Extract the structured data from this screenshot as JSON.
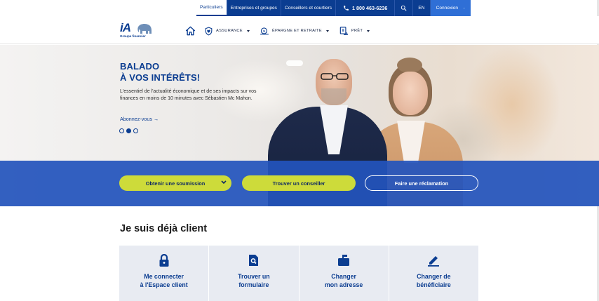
{
  "topbar": {
    "items": [
      {
        "label": "Particuliers"
      },
      {
        "label": "Entreprises et groupes"
      },
      {
        "label": "Conseillers et courtiers"
      },
      {
        "label": "1 800 463-6236"
      },
      {
        "label": "EN"
      },
      {
        "label": "Connexion"
      }
    ]
  },
  "logo": {
    "mark": "iA",
    "subtitle": "Groupe financier"
  },
  "mainnav": {
    "items": [
      {
        "label": "ASSURANCE"
      },
      {
        "label": "ÉPARGNE ET RETRAITE"
      },
      {
        "label": "PRÊT"
      }
    ]
  },
  "hero": {
    "title_line1": "BALADO",
    "title_line2": "À VOS INTÉRÊTS!",
    "text": "L'essentiel de l'actualité économique et de ses impacts sur vos finances en moins de 10 minutes avec Sébastien Mc Mahon.",
    "link": "Abonnez-vous →",
    "carousel_active_index": 1,
    "carousel_count": 3
  },
  "cta": {
    "quote": "Obtenir une soumission",
    "advisor": "Trouver un conseiller",
    "claim": "Faire une réclamation"
  },
  "client": {
    "title": "Je suis déjà client",
    "cards": [
      {
        "label": "Me connecter\nà l'Espace client",
        "icon": "lock-icon"
      },
      {
        "label": "Trouver un\nformulaire",
        "icon": "document-search-icon"
      },
      {
        "label": "Changer\nmon adresse",
        "icon": "mailbox-icon"
      },
      {
        "label": "Changer de\nbénéficiaire",
        "icon": "pencil-icon"
      }
    ]
  },
  "colors": {
    "brand_blue": "#0b3d91",
    "band_blue": "#2454bc",
    "cta_lime": "#cddb3a",
    "connexion_blue": "#2f6fd6"
  }
}
